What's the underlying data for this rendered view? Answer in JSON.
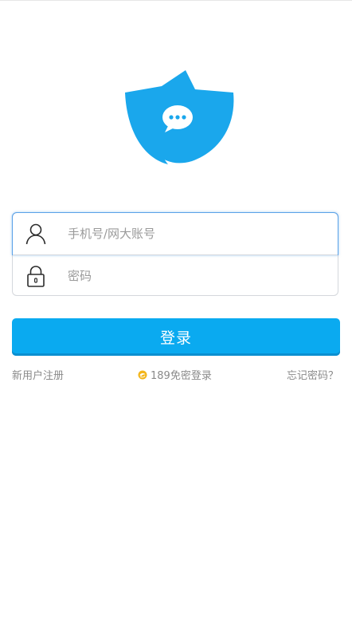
{
  "logo": {
    "icon": "petal-chat-logo-icon",
    "color": "#1aa7ec"
  },
  "form": {
    "username": {
      "placeholder": "手机号/网大账号",
      "value": "",
      "icon": "user-icon"
    },
    "password": {
      "placeholder": "密码",
      "value": "",
      "icon": "lock-icon"
    }
  },
  "login_button": {
    "label": "登录",
    "color": "#0aaaf0"
  },
  "links": {
    "register": "新用户注册",
    "free_login": "189免密登录",
    "free_login_icon": "telecom-swirl-icon",
    "forgot_password": "忘记密码？"
  },
  "colors": {
    "accent": "#0aaaf0",
    "focus_border": "#5aa2e8",
    "link_text": "#8a8a8a"
  }
}
